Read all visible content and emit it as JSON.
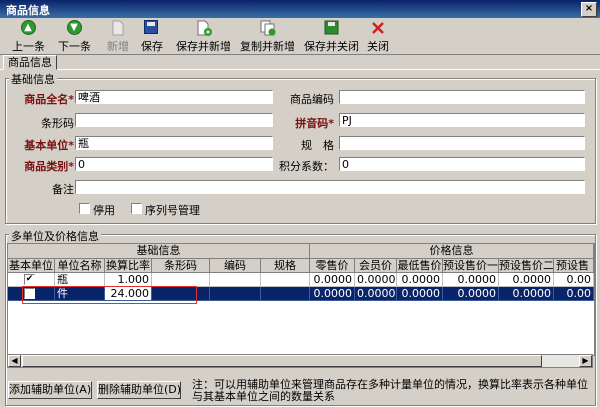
{
  "window": {
    "title": "商品信息",
    "close": "×"
  },
  "toolbar": {
    "prev": "上一条",
    "next": "下一条",
    "new": "新增",
    "save": "保存",
    "save_new": "保存并新增",
    "copy_new": "复制并新增",
    "save_close": "保存并关闭",
    "close": "关闭"
  },
  "tab": {
    "label": "商品信息"
  },
  "basic": {
    "group_title": "基础信息",
    "full_name_label": "商品全名*",
    "full_name_value": "啤酒",
    "code_label": "商品编码",
    "code_value": "",
    "barcode_label": "条形码",
    "barcode_value": "",
    "pinyin_label": "拼音码*",
    "pinyin_value": "PJ",
    "unit_label": "基本单位*",
    "unit_value": "瓶",
    "spec_label": "规　格",
    "spec_value": "",
    "category_label": "商品类别*",
    "category_value": "0",
    "points_label": "积分系数：",
    "points_value": "0",
    "remark_label": "备注",
    "remark_value": "",
    "disabled_label": "停用",
    "serial_label": "序列号管理"
  },
  "units": {
    "group_title": "多单位及价格信息",
    "header_basic": "基础信息",
    "header_price": "价格信息",
    "columns": [
      "基本单位",
      "单位名称",
      "换算比率",
      "条形码",
      "编码",
      "规格",
      "零售价",
      "会员价",
      "最低售价",
      "预设售价一",
      "预设售价二",
      "预设售"
    ],
    "rows": [
      {
        "base": "✔",
        "name": "瓶",
        "ratio": "1.000",
        "barcode": "",
        "code": "",
        "spec": "",
        "p1": "0.0000",
        "p2": "0.0000",
        "p3": "0.0000",
        "p4": "0.0000",
        "p5": "0.0000",
        "p6": "0.00"
      },
      {
        "base": "",
        "name": "件",
        "ratio": "24.000",
        "barcode": "",
        "code": "",
        "spec": "",
        "p1": "0.0000",
        "p2": "0.0000",
        "p3": "0.0000",
        "p4": "0.0000",
        "p5": "0.0000",
        "p6": "0.00"
      }
    ],
    "add_button": "添加辅助单位(A)",
    "delete_button": "删除辅助单位(D)",
    "note": "注：可以用辅助单位来管理商品存在多种计量单位的情况，换算比率表示各种单位与其基本单位之间的数量关系"
  },
  "colors": {
    "titlebar": "#0a246a",
    "selection": "#0a246a",
    "required": "#7a1010",
    "highlight_box": "#e03030"
  },
  "icons": [
    "prev-icon",
    "next-icon",
    "new-icon",
    "save-icon",
    "save-new-icon",
    "copy-new-icon",
    "save-close-icon",
    "close-icon"
  ]
}
